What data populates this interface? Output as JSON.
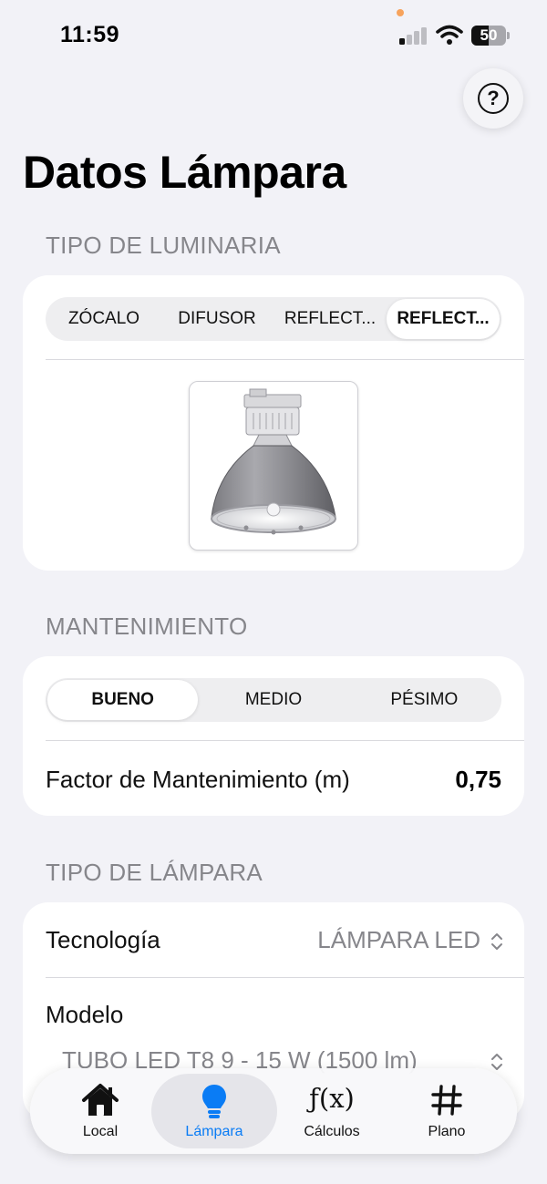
{
  "status_bar": {
    "time": "11:59",
    "battery_level": "50",
    "battery_fraction": 0.5
  },
  "help": {
    "glyph": "?"
  },
  "page": {
    "title": "Datos Lámpara"
  },
  "luminaria": {
    "header": "TIPO DE LUMINARIA",
    "segments": [
      "ZÓCALO",
      "DIFUSOR",
      "REFLECT...",
      "REFLECT..."
    ],
    "selected_index": 3
  },
  "mantenimiento": {
    "header": "MANTENIMIENTO",
    "segments": [
      "BUENO",
      "MEDIO",
      "PÉSIMO"
    ],
    "selected_index": 0,
    "factor_label": "Factor de Mantenimiento (m)",
    "factor_value": "0,75"
  },
  "lampara": {
    "header": "TIPO DE LÁMPARA",
    "tecnologia_label": "Tecnología",
    "tecnologia_value": "LÁMPARA LED",
    "modelo_label": "Modelo",
    "modelo_value": "TUBO LED T8 9 - 15 W (1500 lm)"
  },
  "tab_bar": {
    "tabs": [
      {
        "label": "Local",
        "icon": "house-icon"
      },
      {
        "label": "Lámpara",
        "icon": "lightbulb-icon"
      },
      {
        "label": "Cálculos",
        "icon": "function-icon",
        "glyph": "ƒ(x)"
      },
      {
        "label": "Plano",
        "icon": "number-sign-icon"
      }
    ],
    "active_index": 1
  },
  "colors": {
    "background": "#f2f2f7",
    "accent": "#0a7cf5",
    "secondary_text": "#86868b",
    "privacy_dot": "#f7a35c"
  }
}
